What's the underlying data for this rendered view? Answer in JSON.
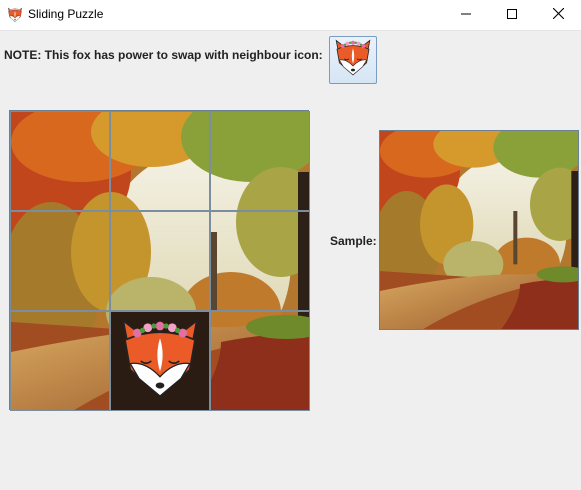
{
  "window": {
    "title": "Sliding Puzzle",
    "app_icon": "fox-icon",
    "controls": [
      "minimize-icon",
      "maximize-icon",
      "close-icon"
    ]
  },
  "note": {
    "text": "NOTE: This fox has power to swap with neighbour icon:",
    "button_icon": "fox-icon"
  },
  "board": {
    "rows": 3,
    "cols": 3,
    "tiles": [
      {
        "row": 0,
        "col": 0,
        "content": "landscape-piece"
      },
      {
        "row": 0,
        "col": 1,
        "content": "landscape-piece"
      },
      {
        "row": 0,
        "col": 2,
        "content": "landscape-piece"
      },
      {
        "row": 1,
        "col": 0,
        "content": "landscape-piece"
      },
      {
        "row": 1,
        "col": 1,
        "content": "landscape-piece"
      },
      {
        "row": 1,
        "col": 2,
        "content": "landscape-piece"
      },
      {
        "row": 2,
        "col": 0,
        "content": "landscape-piece"
      },
      {
        "row": 2,
        "col": 1,
        "content": "fox"
      },
      {
        "row": 2,
        "col": 2,
        "content": "landscape-piece"
      }
    ]
  },
  "sample": {
    "label": "Sample:",
    "image": "autumn-forest-path"
  },
  "colors": {
    "fox_orange": "#ea5b28",
    "background": "#efefef"
  }
}
